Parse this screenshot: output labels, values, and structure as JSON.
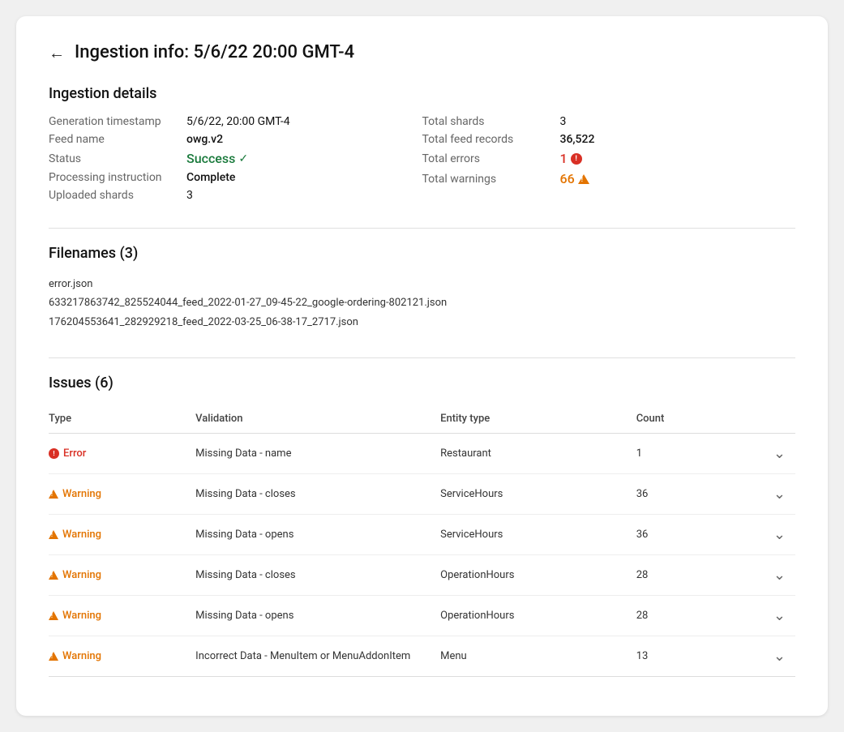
{
  "header": {
    "back_label": "←",
    "title": "Ingestion info: 5/6/22 20:00 GMT-4"
  },
  "ingestion_details": {
    "section_title": "Ingestion details",
    "left": {
      "generation_timestamp_label": "Generation timestamp",
      "generation_timestamp_value": "5/6/22, 20:00 GMT-4",
      "feed_name_label": "Feed name",
      "feed_name_value": "owg.v2",
      "status_label": "Status",
      "status_value": "Success",
      "processing_instruction_label": "Processing instruction",
      "processing_instruction_value": "Complete",
      "uploaded_shards_label": "Uploaded shards",
      "uploaded_shards_value": "3"
    },
    "right": {
      "total_shards_label": "Total shards",
      "total_shards_value": "3",
      "total_feed_records_label": "Total feed records",
      "total_feed_records_value": "36,522",
      "total_errors_label": "Total errors",
      "total_errors_value": "1",
      "total_warnings_label": "Total warnings",
      "total_warnings_value": "66"
    }
  },
  "filenames": {
    "section_title": "Filenames (3)",
    "files": [
      "error.json",
      "633217863742_825524044_feed_2022-01-27_09-45-22_google-ordering-802121.json",
      "176204553641_282929218_feed_2022-03-25_06-38-17_2717.json"
    ]
  },
  "issues": {
    "section_title": "Issues (6)",
    "columns": [
      "Type",
      "Validation",
      "Entity type",
      "Count"
    ],
    "rows": [
      {
        "type": "Error",
        "type_kind": "error",
        "validation": "Missing Data - name",
        "entity_type": "Restaurant",
        "count": "1"
      },
      {
        "type": "Warning",
        "type_kind": "warning",
        "validation": "Missing Data - closes",
        "entity_type": "ServiceHours",
        "count": "36"
      },
      {
        "type": "Warning",
        "type_kind": "warning",
        "validation": "Missing Data - opens",
        "entity_type": "ServiceHours",
        "count": "36"
      },
      {
        "type": "Warning",
        "type_kind": "warning",
        "validation": "Missing Data - closes",
        "entity_type": "OperationHours",
        "count": "28"
      },
      {
        "type": "Warning",
        "type_kind": "warning",
        "validation": "Missing Data - opens",
        "entity_type": "OperationHours",
        "count": "28"
      },
      {
        "type": "Warning",
        "type_kind": "warning",
        "validation": "Incorrect Data - MenuItem or MenuAddonItem",
        "entity_type": "Menu",
        "count": "13"
      }
    ]
  }
}
